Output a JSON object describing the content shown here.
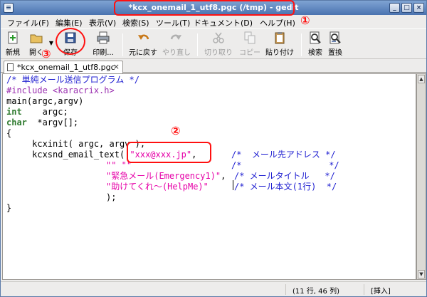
{
  "window": {
    "title": "*kcx_onemail_1_utf8.pgc (/tmp) - gedit"
  },
  "menu": [
    "ファイル(F)",
    "編集(E)",
    "表示(V)",
    "検索(S)",
    "ツール(T)",
    "ドキュメント(D)",
    "ヘルプ(H)"
  ],
  "toolbar": {
    "new": "新規",
    "open": "開く",
    "save": "保存",
    "print": "印刷...",
    "undo": "元に戻す",
    "redo": "やり直し",
    "cut": "切り取り",
    "copy": "コピー",
    "paste": "貼り付け",
    "find": "検索",
    "replace": "置換"
  },
  "tab": {
    "label": "*kcx_onemail_1_utf8.pgc"
  },
  "code": {
    "l1": "/* 単純メール送信プログラム */",
    "l2": "#include <karacrix.h>",
    "l3": "main(argc,argv)",
    "l4_kw": "int",
    "l4_rest": "    argc;",
    "l5_kw": "char",
    "l5_rest": "  *argv[];",
    "l6": "{",
    "l7": "     kcxinit( argc, argv );",
    "l8_a": "     kcxsnd_email_text( ",
    "l8_str": "\"xxx@xxx.jp\"",
    "l8_c": ",",
    "l8_cm": "/*  メール先アドレス */",
    "l9_str": "\"\" \"\"",
    "l9_cm": "/*                 */",
    "l10_str": "\"緊急メール(Emergency1)\"",
    "l10_c": ",",
    "l10_cm": "/* メールタイトル   */",
    "l11_str": "\"助けてくれ～(HelpMe)\"",
    "l11_cm": "/* メール本文(1行)  */",
    "l12": ");",
    "l13": "}"
  },
  "status": {
    "position": "(11 行, 46 列)",
    "mode": "[挿入]"
  },
  "annotations": {
    "one": "①",
    "two": "②",
    "three": "③"
  },
  "colors": {
    "comment": "#1c1cd0",
    "preprocessor": "#9a2fb0",
    "keyword": "#2e7a2e",
    "string": "#e600a8",
    "annotation": "#ff1010"
  }
}
